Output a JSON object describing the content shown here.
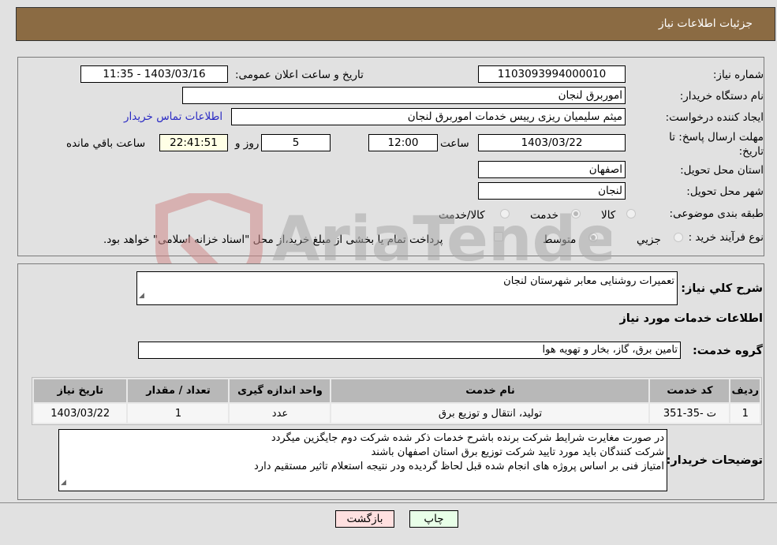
{
  "header": {
    "title": "جزئیات اطلاعات نیاز"
  },
  "fields": {
    "need_number": {
      "label": "شماره نیاز:",
      "value": "1103093994000010"
    },
    "announce_datetime": {
      "label": "تاریخ و ساعت اعلان عمومی:",
      "value": "1403/03/16 - 11:35"
    },
    "buyer_org": {
      "label": "نام دستگاه خریدار:",
      "value": "اموربرق لنجان"
    },
    "requester": {
      "label": "ایجاد کننده درخواست:",
      "value": "میثم سلیمیان ریزی رییس خدمات  اموربرق لنجان"
    },
    "buyer_contact_link": "اطلاعات تماس خریدار",
    "deadline": {
      "label": "مهلت ارسال پاسخ: تا تاریخ:",
      "date": "1403/03/22",
      "time_label": "ساعت",
      "time": "12:00",
      "days": "5",
      "days_label": "روز و",
      "remaining": "22:41:51",
      "remaining_label": "ساعت باقي مانده"
    },
    "province": {
      "label": "استان محل تحویل:",
      "value": "اصفهان"
    },
    "city": {
      "label": "شهر محل تحویل:",
      "value": "لنجان"
    },
    "category": {
      "label": "طبقه بندی موضوعی:",
      "options": [
        "کالا",
        "خدمت",
        "کالا/خدمت"
      ],
      "selected": "خدمت"
    },
    "purchase_type": {
      "label": "نوع فرآیند خرید :",
      "options": [
        "جزيي",
        "متوسط"
      ],
      "selected": "متوسط",
      "treasury_checkbox_label": "پرداخت تمام یا بخشی از مبلغ خرید،از محل \"اسناد خزانه اسلامی\" خواهد بود.",
      "treasury_checked": false
    }
  },
  "details": {
    "general_desc_label": "شرح كلي نياز:",
    "general_desc": "تعمیرات روشنایی معابر شهرستان لنجان",
    "services_title": "اطلاعات خدمات مورد نیاز",
    "service_group_label": "گروه خدمت:",
    "service_group": "تامین برق، گاز، بخار و تهویه هوا",
    "table": {
      "headers": [
        "ردیف",
        "کد خدمت",
        "نام خدمت",
        "واحد اندازه گیری",
        "تعداد / مقدار",
        "تاریخ نیاز"
      ],
      "rows": [
        [
          "1",
          "ت -35-351",
          "تولید، انتقال و توزیع برق",
          "عدد",
          "1",
          "1403/03/22"
        ]
      ]
    },
    "buyer_notes_label": "توضیحات خریدار:",
    "buyer_notes": [
      "در صورت مغایرت شرایط شرکت برنده باشرح خدمات ذکر شده شرکت دوم جایگزین میگردد",
      "شرکت کنندگان باید مورد تایید شرکت توزیع برق استان اصفهان باشند",
      "امتیاز فنی بر اساس پروژه های انجام شده قبل لحاظ گردیده ودر نتیجه استعلام تاثیر مستقیم دارد"
    ]
  },
  "buttons": {
    "print": "چاپ",
    "back": "بازگشت"
  },
  "watermark": {
    "text": "AriaTender.neT"
  },
  "colors": {
    "header_bg": "#8b6b43",
    "link": "#2a2ac4",
    "back_btn": "#ffe0e0",
    "print_btn": "#e8ffe8",
    "remaining_bg": "#ffffe6"
  }
}
